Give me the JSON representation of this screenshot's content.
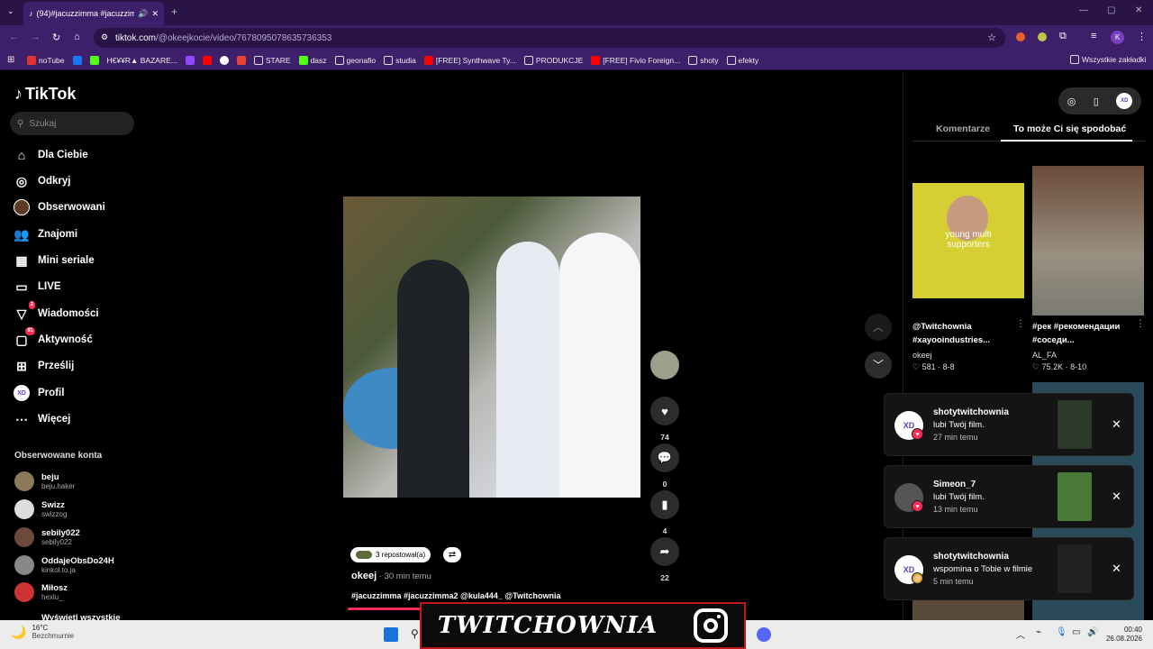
{
  "browser": {
    "tab_title": "(94)#jacuzzimma #jacuzzim",
    "url_host": "tiktok.com",
    "url_path": "/@okeejkocie/video/7678095078635736353",
    "bookmarks": [
      "noTube",
      "H€¥¥R▲ BAZARE...",
      "STARE",
      "dasz",
      "geonafio",
      "studia",
      "[FREE] Synthwave Ty...",
      "PRODUKCJE",
      "[FREE] Fivio Foreign...",
      "shoty",
      "efekty"
    ],
    "all_bookmarks": "Wszystkie zakładki"
  },
  "sidebar": {
    "logo": "TikTok",
    "search_placeholder": "Szukaj",
    "nav": [
      {
        "label": "Dla Ciebie",
        "icon": "home-icon"
      },
      {
        "label": "Odkryj",
        "icon": "compass-icon"
      },
      {
        "label": "Obserwowani",
        "icon": "following-avatar-icon"
      },
      {
        "label": "Znajomi",
        "icon": "friends-icon"
      },
      {
        "label": "Mini seriale",
        "icon": "film-icon"
      },
      {
        "label": "LIVE",
        "icon": "live-icon"
      },
      {
        "label": "Wiadomości",
        "icon": "messages-icon",
        "badge": "3"
      },
      {
        "label": "Aktywność",
        "icon": "activity-icon",
        "badge": "91"
      },
      {
        "label": "Prześlij",
        "icon": "upload-icon"
      },
      {
        "label": "Profil",
        "icon": "profile-icon"
      },
      {
        "label": "Więcej",
        "icon": "more-icon"
      }
    ],
    "following_title": "Obserwowane konta",
    "accounts": [
      {
        "name": "beju",
        "handle": "beju.haker"
      },
      {
        "name": "Swizz",
        "handle": "swizzog"
      },
      {
        "name": "sebily022",
        "handle": "sebily022"
      },
      {
        "name": "OddajeObsDo24H",
        "handle": "kinkol.to.ja"
      },
      {
        "name": "Miłosz",
        "handle": "hexlu_"
      }
    ],
    "show_all": "Wyświetl wszystkie"
  },
  "video": {
    "likes": "74",
    "comments": "0",
    "saves": "4",
    "shares": "22",
    "reposted": "3 repostował(a)",
    "author": "okeej",
    "time": " · 30 min temu",
    "description": "#jacuzzimma #jacuzzimma2 @kula444_ @Twitchownia",
    "progress": 0.27
  },
  "right": {
    "tab_comments": "Komentarze",
    "tab_like": "To może Ci się spodobać",
    "videos": [
      {
        "caption1": "@Twitchownia",
        "caption2": "#xayooindustries...",
        "author": "okeej",
        "stats": "♡ 581 · 8-8",
        "overlay": "young multi supporters"
      },
      {
        "caption1": "#рек #рекомендации",
        "caption2": "#соседи...",
        "author": "AL_FA",
        "stats": "♡ 75.2K · 8-10"
      }
    ]
  },
  "notifications": [
    {
      "name": "shotytwitchownia",
      "message": "lubi Twój film.",
      "time": "27 min temu",
      "avatar": "XD"
    },
    {
      "name": "Simeon_7",
      "message": "lubi Twój film.",
      "time": "13 min temu",
      "avatar": ""
    },
    {
      "name": "shotytwitchownia",
      "message": "wspomina o Tobie w filmie",
      "time": "5 min temu",
      "avatar": "XD"
    }
  ],
  "overlay": {
    "banner": "TWITCHOWNIA"
  },
  "taskbar": {
    "temp": "16°C",
    "weather": "Bezchmurnie",
    "time": "00:40",
    "date": "26.08.2026"
  },
  "colors": {
    "accent": "#fe2c55",
    "browser": "#3d1f6a"
  }
}
